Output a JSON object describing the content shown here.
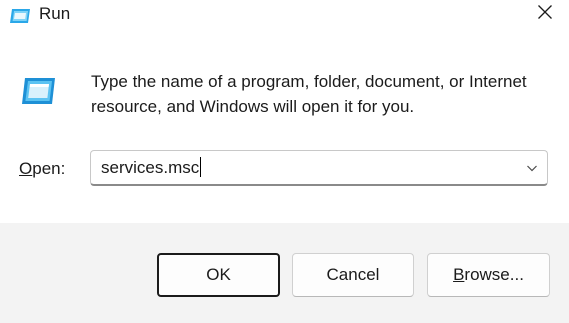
{
  "window": {
    "title": "Run",
    "app_icon": "run-icon",
    "close_icon": "close-icon"
  },
  "body": {
    "icon": "run-icon",
    "description": "Type the name of a program, folder, document, or Internet resource, and Windows will open it for you."
  },
  "open_field": {
    "label": "Open:",
    "value": "services.msc",
    "chevron_icon": "chevron-down-icon"
  },
  "buttons": {
    "ok": "OK",
    "cancel": "Cancel",
    "browse": "Browse..."
  },
  "colors": {
    "footer_background": "#f3f3f3",
    "icon_blue": "#1e90d6"
  }
}
